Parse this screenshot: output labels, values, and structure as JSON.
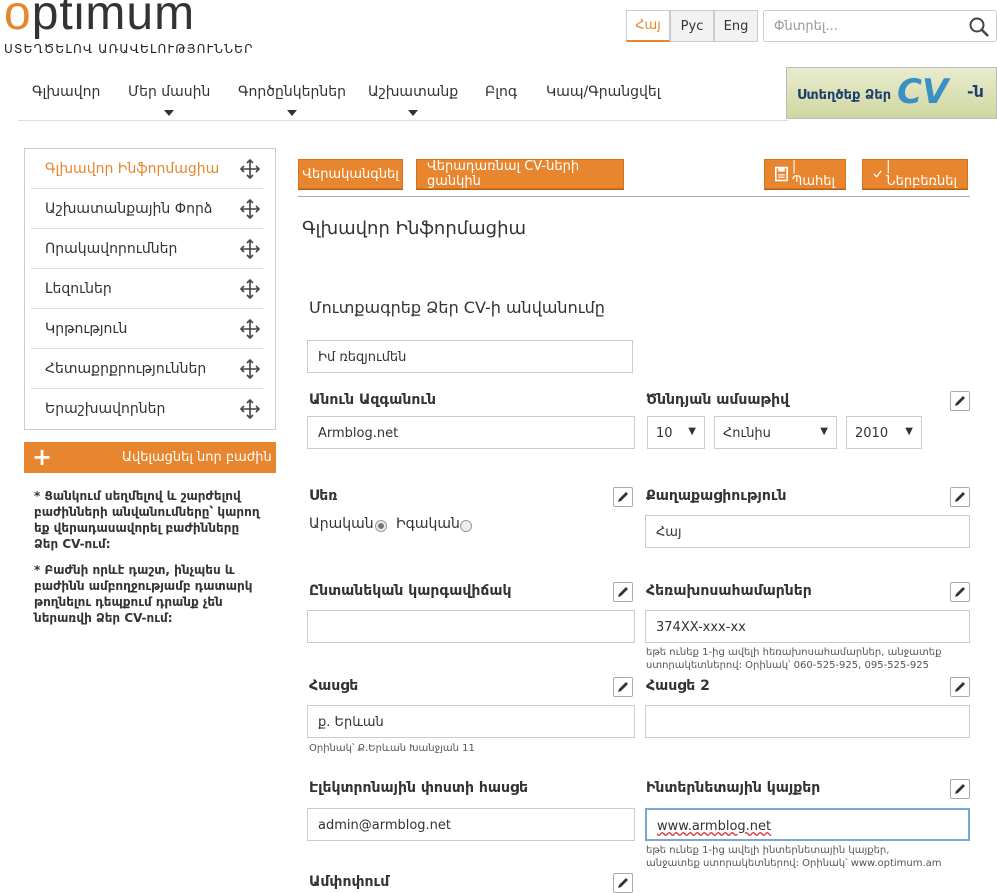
{
  "header": {
    "logo_o": "o",
    "logo_rest": "ptimum",
    "tagline": "ՍՏԵՂԾԵԼՈՎ ԱՌԱՎԵԼՈՒԹՅՈՒՆՆԵՐ",
    "languages": [
      "Հայ",
      "Рус",
      "Eng"
    ],
    "active_language": "Հայ",
    "search_placeholder": "Փնտրել..."
  },
  "nav": {
    "items": [
      "Գլխավոր",
      "Մեր մասին",
      "Գործընկերներ",
      "Աշխատանք",
      "Բլոգ",
      "Կապ/Գրանցվել"
    ],
    "banner_text": "Ստեղծեք Ձեր",
    "banner_cv": "CV",
    "banner_suffix": "-ն"
  },
  "sidebar": {
    "items": [
      "Գլխավոր Ինֆորմացիա",
      "Աշխատանքային Փորձ",
      "Որակավորումներ",
      "Լեզուներ",
      "Կրթություն",
      "Հետաքրքրություններ",
      "Երաշխավորներ"
    ],
    "active_index": 0,
    "add_section": "Ավելացնել նոր բաժին",
    "note1": "* Ցանկում սեղմելով և շարժելով բաժինների անվանումները՝ կարող եք վերադասավորել բաժինները Ձեր CV-ում:",
    "note2": "* Բաժնի որևէ դաշտ, ինչպես և բաժինն ամբողջությամբ դատարկ թողնելու դեպքում դրանք չեն ներառվի Ձեր CV-ում:"
  },
  "toolbar": {
    "preview": "Վերականգնել",
    "back": "Վերադառնալ CV-ների ցանկին",
    "save": "| Պահել",
    "include": "| Ներբեռնել"
  },
  "form": {
    "title": "Գլխավոր Ինֆորմացիա",
    "cv_name_label": "Մուտքագրեք Ձեր CV-ի անվանումը",
    "cv_name_value": "Իմ ռեզյումեն",
    "name_label": "Անուն Ազգանուն",
    "name_value": "Armblog.net",
    "dob_label": "Ծննդյան ամսաթիվ",
    "dob_day": "10",
    "dob_month": "Հունիս",
    "dob_year": "2010",
    "gender_label": "Սեռ",
    "gender_male": "Արական",
    "gender_female": "Իգական",
    "gender_selected": "male",
    "citizenship_label": "Քաղաքացիություն",
    "citizenship_value": "Հայ",
    "marital_label": "Ընտանեկան կարգավիճակ",
    "marital_value": "",
    "phone_label": "Հեռախոսահամարներ",
    "phone_value": "374XX-xxx-xx",
    "phone_hint": "եթե ունեք 1-ից ավելի հեռախոսահամարներ, անջատեք ստորակետներով: Օրինակ՝ 060-525-925, 095-525-925",
    "address_label": "Հասցե",
    "address_value": "ք. Երևան",
    "address_hint": "Օրինակ՝ Ք.Երևան Խանջյան 11",
    "address2_label": "Հասցե 2",
    "address2_value": "",
    "email_label": "Էլեկտրոնային փոստի հասցե",
    "email_value": "admin@armblog.net",
    "web_label": "Ինտերնետային կայքեր",
    "web_value": "www.armblog.net",
    "web_hint": "եթե ունեք 1-ից ավելի ինտերնետային կայքեր, անջատեք ստորակետներով: Օրինակ՝ www.optimum.am",
    "summary_label": "Ամփոփում"
  },
  "colors": {
    "accent": "#e8862f",
    "text": "#333333",
    "border": "#cccccc"
  }
}
